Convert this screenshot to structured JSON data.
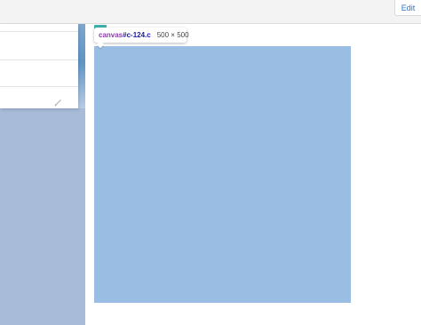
{
  "toolbar": {
    "edit_label": "Edit",
    "accent_color": "#2a74c9"
  },
  "inspector_tooltip": {
    "element_tag": "canvas",
    "element_selector": "#c-124.c",
    "element_size": "500 × 500"
  },
  "side_panel": {
    "edit_icon": "pencil-icon"
  },
  "colors": {
    "canvas_fill": "#9abde4",
    "left_background": "#a8bbd9",
    "selector_tag_color": "#8a3ea7",
    "selector_id_color": "#1a1aa6"
  }
}
